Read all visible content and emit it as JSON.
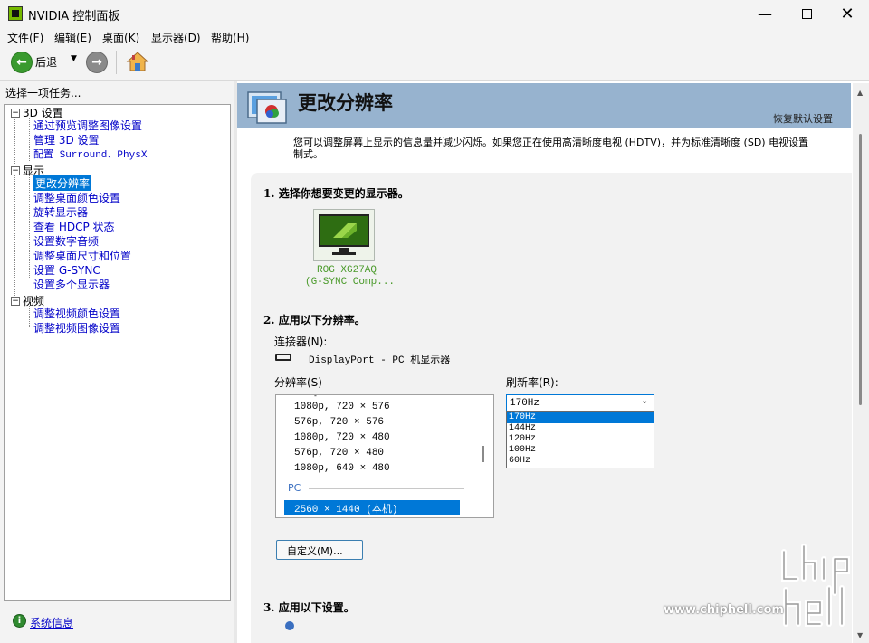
{
  "window": {
    "title": "NVIDIA 控制面板"
  },
  "menu": [
    "文件(F)",
    "编辑(E)",
    "桌面(K)",
    "显示器(D)",
    "帮助(H)"
  ],
  "toolbar": {
    "back_label": "后退"
  },
  "left": {
    "task_prompt": "选择一项任务...",
    "tree": {
      "cat_3d": "3D 设置",
      "i_3d_1": "通过预览调整图像设置",
      "i_3d_2": "管理 3D 设置",
      "i_3d_3": "配置 Surround、PhysX",
      "cat_display": "显示",
      "i_d_1": "更改分辨率",
      "i_d_2": "调整桌面颜色设置",
      "i_d_3": "旋转显示器",
      "i_d_4": "查看 HDCP 状态",
      "i_d_5": "设置数字音频",
      "i_d_6": "调整桌面尺寸和位置",
      "i_d_7": "设置 G-SYNC",
      "i_d_8": "设置多个显示器",
      "cat_video": "视频",
      "i_v_1": "调整视频颜色设置",
      "i_v_2": "调整视频图像设置"
    },
    "system_info": "系统信息"
  },
  "main": {
    "page_title": "更改分辨率",
    "restore_defaults": "恢复默认设置",
    "description_line1": "您可以调整屏幕上显示的信息量并减少闪烁。如果您正在使用高清晰度电视 (HDTV)，并为标准清晰度 (SD) 电视设置",
    "description_line2": "制式。",
    "section1": "1. 选择你想要变更的显示器。",
    "monitor_name1": "ROG XG27AQ",
    "monitor_name2": "(G-SYNC Comp...",
    "section2": "2. 应用以下分辨率。",
    "connector_label": "连接器(N):",
    "connector_value": "DisplayPort - PC 机显示器",
    "resolution_label": "分辨率(S)",
    "resolution_items": [
      "1080p, 720 × 576",
      "576p, 720 × 576",
      "1080p, 720 × 480",
      "576p, 720 × 480",
      "1080p, 640 × 480"
    ],
    "pc_group": "PC",
    "selected_resolution": "2560 × 1440 (本机)",
    "refresh_label": "刷新率(R):",
    "refresh_selected": "170Hz",
    "refresh_options": [
      "170Hz",
      "144Hz",
      "120Hz",
      "100Hz",
      "60Hz"
    ],
    "custom_button": "自定义(M)...",
    "section3": "3. 应用以下设置。"
  },
  "watermark": {
    "logo": "chip hell",
    "url": "www.chiphell.com"
  },
  "colors": {
    "accent": "#76b900",
    "header": "#97b3cf",
    "selection": "#0078d7"
  }
}
